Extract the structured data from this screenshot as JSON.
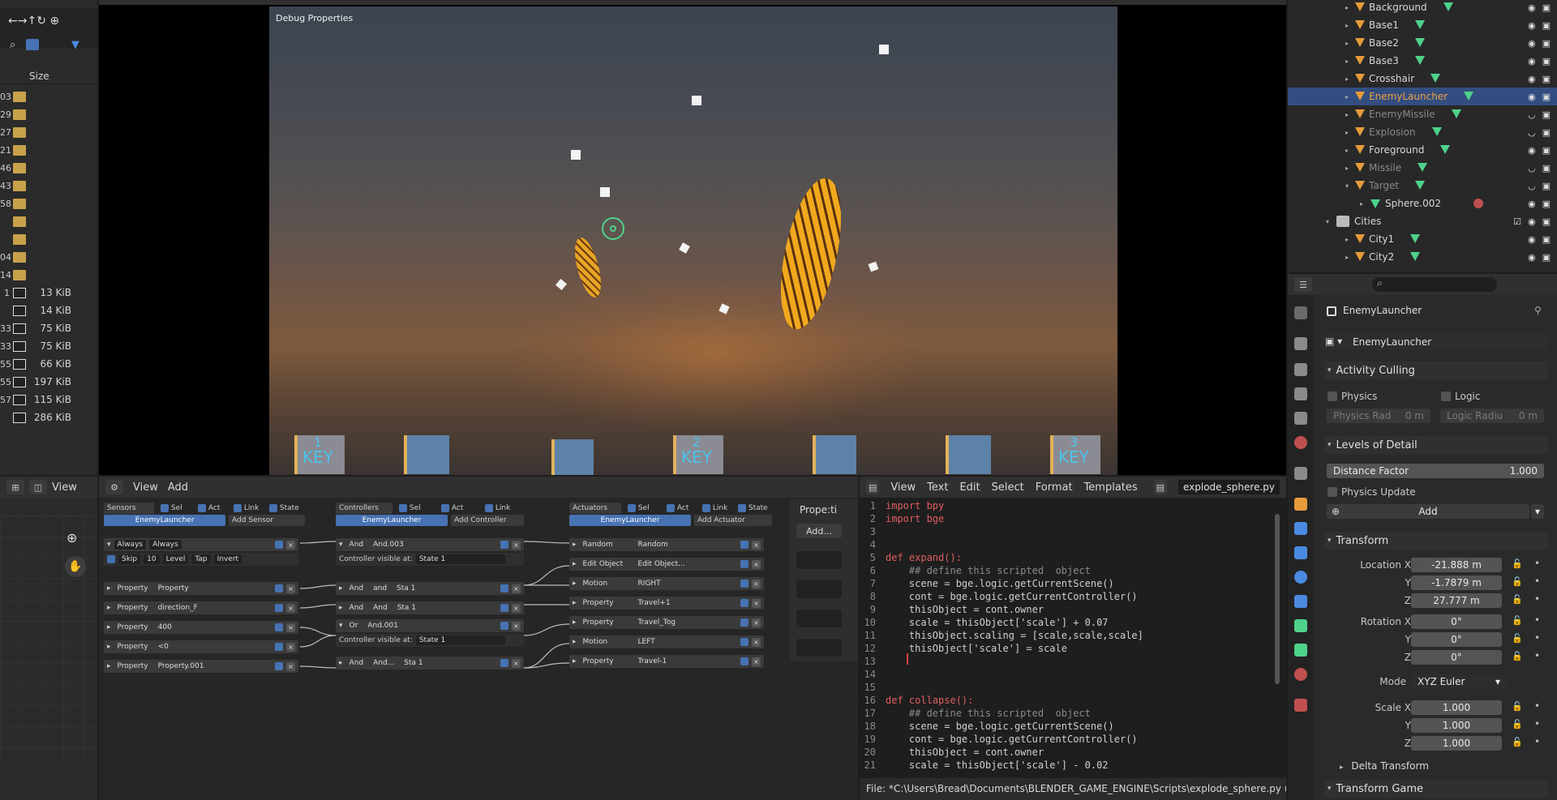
{
  "file_browser": {
    "size_header": "Size",
    "rows": [
      {
        "num": "03",
        "type": "folder",
        "size": ""
      },
      {
        "num": "29",
        "type": "folder",
        "size": ""
      },
      {
        "num": "27",
        "type": "folder",
        "size": ""
      },
      {
        "num": "21",
        "type": "folder",
        "size": ""
      },
      {
        "num": "46",
        "type": "folder",
        "size": ""
      },
      {
        "num": "43",
        "type": "folder",
        "size": ""
      },
      {
        "num": "58",
        "type": "folder",
        "size": ""
      },
      {
        "num": "",
        "type": "folder",
        "size": ""
      },
      {
        "num": "",
        "type": "folder",
        "size": ""
      },
      {
        "num": "04",
        "type": "folder",
        "size": ""
      },
      {
        "num": "14",
        "type": "folder",
        "size": ""
      },
      {
        "num": "1",
        "type": "image",
        "size": "13 KiB"
      },
      {
        "num": "",
        "type": "image",
        "size": "14 KiB"
      },
      {
        "num": "33",
        "type": "image",
        "size": "75 KiB"
      },
      {
        "num": "33",
        "type": "image",
        "size": "75 KiB"
      },
      {
        "num": "55",
        "type": "image",
        "size": "66 KiB"
      },
      {
        "num": "55",
        "type": "image",
        "size": "197 KiB"
      },
      {
        "num": "57",
        "type": "image",
        "size": "115 KiB"
      },
      {
        "num": "",
        "type": "image",
        "size": "286 KiB"
      }
    ]
  },
  "viewport": {
    "overlay_label": "Debug Properties",
    "keys": [
      {
        "num": "1",
        "label": "KEY"
      },
      {
        "num": "2",
        "label": "KEY"
      },
      {
        "num": "3",
        "label": "KEY"
      }
    ]
  },
  "logic_editor": {
    "header": {
      "view": "View",
      "add": "Add"
    },
    "sensors": {
      "title": "Sensors",
      "filters": [
        "Sel",
        "Act",
        "Link",
        "State"
      ],
      "object": "EnemyLauncher",
      "add": "Add Sensor",
      "first": {
        "type": "Always",
        "name": "Always",
        "skip": "Skip",
        "skip_val": "10",
        "level": "Level",
        "tap": "Tap",
        "invert": "Invert"
      },
      "items": [
        {
          "type": "Property",
          "name": "Property"
        },
        {
          "type": "Property",
          "name": "direction_F"
        },
        {
          "type": "Property",
          "name": "400"
        },
        {
          "type": "Property",
          "name": "<0"
        },
        {
          "type": "Property",
          "name": "Property.001"
        }
      ]
    },
    "controllers": {
      "title": "Controllers",
      "filters": [
        "Sel",
        "Act",
        "Link"
      ],
      "object": "EnemyLauncher",
      "add": "Add Controller",
      "visible_label": "Controller visible at:",
      "state": "State 1",
      "items": [
        {
          "type": "And",
          "name": "And.003",
          "state": ""
        },
        {
          "type": "And",
          "name": "and",
          "state": "Sta 1"
        },
        {
          "type": "And",
          "name": "And",
          "state": "Sta 1"
        },
        {
          "type": "Or",
          "name": "And.001",
          "state": ""
        },
        {
          "type": "And",
          "name": "And...",
          "state": "Sta 1"
        }
      ]
    },
    "actuators": {
      "title": "Actuators",
      "filters": [
        "Sel",
        "Act",
        "Link",
        "State"
      ],
      "object": "EnemyLauncher",
      "add": "Add Actuator",
      "items": [
        {
          "type": "Random",
          "name": "Random"
        },
        {
          "type": "Edit Object",
          "name": "Edit Object..."
        },
        {
          "type": "Motion",
          "name": "RIGHT"
        },
        {
          "type": "Property",
          "name": "Travel+1"
        },
        {
          "type": "Property",
          "name": "Travel_Tog"
        },
        {
          "type": "Motion",
          "name": "LEFT"
        },
        {
          "type": "Property",
          "name": "Travel-1"
        }
      ]
    },
    "props_panel": {
      "title": "Prope:ti",
      "add": "Add..."
    }
  },
  "text_editor": {
    "menu": [
      "View",
      "Text",
      "Edit",
      "Select",
      "Format",
      "Templates"
    ],
    "filename": "explode_sphere.py",
    "status": "File: *C:\\Users\\Bread\\Documents\\BLENDER_GAME_ENGINE\\Scripts\\explode_sphere.py (unsav",
    "lines": [
      "import bpy",
      "import bge",
      "",
      "",
      "def expand():",
      "    ## define this scripted  object",
      "    scene = bge.logic.getCurrentScene()",
      "    cont = bge.logic.getCurrentController()",
      "    thisObject = cont.owner",
      "    scale = thisObject['scale'] + 0.07",
      "    thisObject.scaling = [scale,scale,scale]",
      "    thisObject['scale'] = scale",
      "    ",
      "",
      "",
      "def collapse():",
      "    ## define this scripted  object",
      "    scene = bge.logic.getCurrentScene()",
      "    cont = bge.logic.getCurrentController()",
      "    thisObject = cont.owner",
      "    scale = thisObject['scale'] - 0.02"
    ]
  },
  "outliner": {
    "rows": [
      {
        "name": "Background",
        "level": 1,
        "selected": false,
        "dim": false,
        "kind": "obj"
      },
      {
        "name": "Base1",
        "level": 1,
        "selected": false,
        "dim": false,
        "kind": "obj"
      },
      {
        "name": "Base2",
        "level": 1,
        "selected": false,
        "dim": false,
        "kind": "obj"
      },
      {
        "name": "Base3",
        "level": 1,
        "selected": false,
        "dim": false,
        "kind": "obj"
      },
      {
        "name": "Crosshair",
        "level": 1,
        "selected": false,
        "dim": false,
        "kind": "obj"
      },
      {
        "name": "EnemyLauncher",
        "level": 1,
        "selected": true,
        "dim": false,
        "kind": "obj"
      },
      {
        "name": "EnemyMissile",
        "level": 1,
        "selected": false,
        "dim": true,
        "kind": "obj"
      },
      {
        "name": "Explosion",
        "level": 1,
        "selected": false,
        "dim": true,
        "kind": "obj"
      },
      {
        "name": "Foreground",
        "level": 1,
        "selected": false,
        "dim": false,
        "kind": "obj"
      },
      {
        "name": "Missile",
        "level": 1,
        "selected": false,
        "dim": true,
        "kind": "obj"
      },
      {
        "name": "Target",
        "level": 1,
        "selected": false,
        "dim": true,
        "kind": "obj"
      },
      {
        "name": "Sphere.002",
        "level": 2,
        "selected": false,
        "dim": false,
        "kind": "mesh"
      },
      {
        "name": "Cities",
        "level": 0,
        "selected": false,
        "dim": false,
        "kind": "collection"
      },
      {
        "name": "City1",
        "level": 1,
        "selected": false,
        "dim": false,
        "kind": "obj"
      },
      {
        "name": "City2",
        "level": 1,
        "selected": false,
        "dim": false,
        "kind": "obj"
      }
    ]
  },
  "properties": {
    "object_name": "EnemyLauncher",
    "data_name": "EnemyLauncher",
    "activity_culling": {
      "title": "Activity Culling",
      "physics": "Physics",
      "logic": "Logic",
      "physics_rad": "Physics Rad",
      "physics_rad_val": "0 m",
      "logic_radius": "Logic Radiu",
      "logic_radius_val": "0 m"
    },
    "lod": {
      "title": "Levels of Detail",
      "distance_factor": "Distance Factor",
      "distance_factor_val": "1.000",
      "physics_update": "Physics Update",
      "add": "Add"
    },
    "transform": {
      "title": "Transform",
      "location_label": "Location X",
      "location": [
        "-21.888 m",
        "-1.7879 m",
        "27.777 m"
      ],
      "rotation_label": "Rotation X",
      "rotation": [
        "0°",
        "0°",
        "0°"
      ],
      "mode_label": "Mode",
      "mode": "XYZ Euler",
      "scale_label": "Scale X",
      "scale": [
        "1.000",
        "1.000",
        "1.000"
      ],
      "y": "Y",
      "z": "Z",
      "delta": "Delta Transform"
    },
    "transform_game": "Transform Game"
  },
  "colors": {
    "accent": "#4772b3",
    "selected_row": "#334d80",
    "object_orange": "#e59b3a",
    "mesh_green": "#4ed28a",
    "key_blue": "#4cc3ea"
  }
}
